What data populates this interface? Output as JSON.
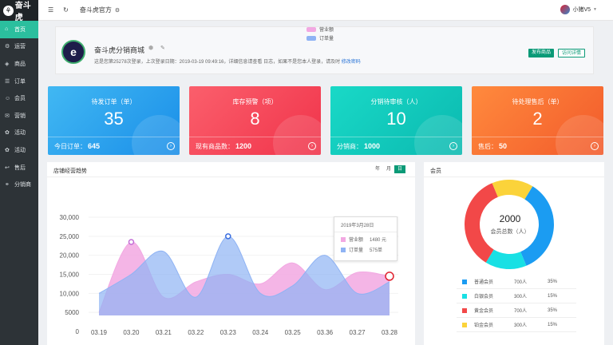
{
  "app": {
    "logo_text": "奋斗虎"
  },
  "sidebar": {
    "items": [
      {
        "label": "首页",
        "icon": "home-icon",
        "glyph": "⌂",
        "active": true
      },
      {
        "label": "运营",
        "icon": "settings-icon",
        "glyph": "⚙"
      },
      {
        "label": "商品",
        "icon": "tag-icon",
        "glyph": "◈"
      },
      {
        "label": "订单",
        "icon": "list-icon",
        "glyph": "☰"
      },
      {
        "label": "会员",
        "icon": "user-icon",
        "glyph": "☺"
      },
      {
        "label": "营销",
        "icon": "megaphone-icon",
        "glyph": "✉"
      },
      {
        "label": "活动",
        "icon": "gift-icon",
        "glyph": "✿"
      },
      {
        "label": "活动",
        "icon": "gift-icon",
        "glyph": "✿"
      },
      {
        "label": "售后",
        "icon": "return-icon",
        "glyph": "↩"
      },
      {
        "label": "分销商",
        "icon": "network-icon",
        "glyph": "⚭"
      }
    ]
  },
  "topbar": {
    "menu_glyph": "☰",
    "refresh_glyph": "↻",
    "title": "奋斗虎官方",
    "settings_glyph": "⚙",
    "user_name": "小猪V5",
    "caret": "▼"
  },
  "profile": {
    "avatar_text": "e",
    "shop_name": "奋斗虎分销商城",
    "shield_glyph": "⬢",
    "edit_glyph": "✎",
    "login_info": "这是您第25278次登录，上次登录日期：2019-03-19 09:49:16，详细信息请查看 日志，如果不是您本人登录，请及时",
    "change_password": "修改密码",
    "publish_btn": "发布商品",
    "visit_btn": "访问详情"
  },
  "stats": [
    {
      "title": "待发订单（单）",
      "value": "35",
      "foot_label": "今日订单：",
      "foot_value": "645",
      "grad": "linear-gradient(135deg,#41b8f3,#1a8ee8)"
    },
    {
      "title": "库存预警（项）",
      "value": "8",
      "foot_label": "现有商品数：",
      "foot_value": "1200",
      "grad": "linear-gradient(135deg,#fb5f6c,#f0334a)"
    },
    {
      "title": "分销待审核（人）",
      "value": "10",
      "foot_label": "分销商：",
      "foot_value": "1000",
      "grad": "linear-gradient(135deg,#19d9c7,#0bb9b0)"
    },
    {
      "title": "待处理售后（单）",
      "value": "2",
      "foot_label": "售后：",
      "foot_value": "50",
      "grad": "linear-gradient(135deg,#ff8a3d,#f25a2b)"
    }
  ],
  "trend": {
    "title": "店铺经营趋势",
    "range": [
      "年",
      "月",
      "日"
    ],
    "active_range": 2,
    "tooltip": {
      "date": "2019年3月28日",
      "rows": [
        {
          "label": "营业额",
          "value": "1480 元"
        },
        {
          "label": "订单量",
          "value": "575单"
        }
      ]
    }
  },
  "chart_data": {
    "type": "area",
    "title": "",
    "x": [
      "03.19",
      "03.20",
      "03.21",
      "03.22",
      "03.23",
      "03.24",
      "03.25",
      "03.36",
      "03.27",
      "03.28"
    ],
    "y_ticks": [
      "0",
      "5000",
      "10,000",
      "15,000",
      "20,000",
      "25,000",
      "30,000"
    ],
    "ylim": [
      0,
      30000
    ],
    "series": [
      {
        "name": "营业额",
        "color": "#f2a8e2",
        "values": [
          5000,
          23500,
          9000,
          13000,
          15000,
          12500,
          18000,
          11000,
          15500,
          14500
        ]
      },
      {
        "name": "订单量",
        "color": "#8fb3f4",
        "values": [
          10000,
          15000,
          21000,
          9000,
          25000,
          10000,
          12000,
          20000,
          10000,
          13000
        ]
      }
    ],
    "markers": [
      {
        "series": 0,
        "index": 1,
        "color": "#c36dd6"
      },
      {
        "series": 1,
        "index": 4,
        "color": "#3c6fe0"
      },
      {
        "series": 0,
        "index": 9,
        "color": "#e0202e"
      }
    ],
    "legend": "top-right"
  },
  "members": {
    "title": "会员",
    "total": "2000",
    "total_label": "会员总数（人）",
    "rows": [
      {
        "name": "普通会员",
        "count": "700人",
        "pct": "35%",
        "color": "#1b9cf2",
        "value": 35
      },
      {
        "name": "白银会员",
        "count": "300人",
        "pct": "15%",
        "color": "#18e0e4",
        "value": 15
      },
      {
        "name": "黄金会员",
        "count": "700人",
        "pct": "35%",
        "color": "#f24848",
        "value": 35
      },
      {
        "name": "铂金会员",
        "count": "300人",
        "pct": "15%",
        "color": "#fbd33a",
        "value": 15
      }
    ]
  }
}
